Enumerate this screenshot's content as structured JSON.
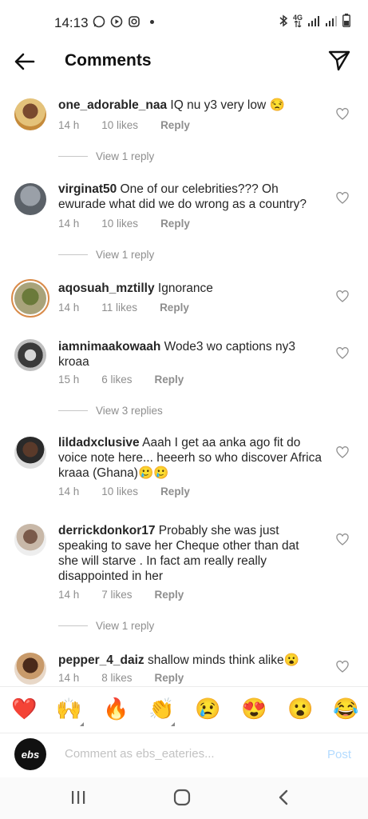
{
  "status_bar": {
    "time": "14:13",
    "network": "4G"
  },
  "header": {
    "title": "Comments"
  },
  "comments": [
    {
      "username": "one_adorable_naa",
      "text": "IQ nu y3 very low 😒",
      "time": "14 h",
      "likes": "10 likes",
      "reply": "Reply",
      "view_replies": "View 1 reply"
    },
    {
      "username": "virginat50",
      "text": "One of our celebrities??? Oh ewurade what did we do wrong as a country?",
      "time": "14 h",
      "likes": "10 likes",
      "reply": "Reply",
      "view_replies": "View 1 reply"
    },
    {
      "username": "aqosuah_mztilly",
      "text": "Ignorance",
      "time": "14 h",
      "likes": "11 likes",
      "reply": "Reply"
    },
    {
      "username": "iamnimaakowaah",
      "text": "Wode3 wo captions ny3 kroaa",
      "time": "15 h",
      "likes": "6 likes",
      "reply": "Reply",
      "view_replies": "View 3 replies"
    },
    {
      "username": "lildadxclusive",
      "text": "Aaah I get aa anka ago fit do voice note here... heeerh so who discover Africa kraaa (Ghana)🥲🥲",
      "time": "14 h",
      "likes": "10 likes",
      "reply": "Reply"
    },
    {
      "username": "derrickdonkor17",
      "text": "Probably she was just speaking to save her Cheque other than dat she will starve .  In fact am really really disappointed in her",
      "time": "14 h",
      "likes": "7 likes",
      "reply": "Reply",
      "view_replies": "View 1 reply"
    },
    {
      "username": "pepper_4_daiz",
      "text": "shallow minds think alike😮",
      "time": "14 h",
      "likes": "8 likes",
      "reply": "Reply"
    }
  ],
  "reactions": [
    "❤️",
    "🙌",
    "🔥",
    "👏",
    "😢",
    "😍",
    "😮",
    "😂"
  ],
  "composer": {
    "avatar_text": "ebs",
    "placeholder": "Comment as ebs_eateries...",
    "post_label": "Post"
  },
  "colors": {
    "meta_gray": "#8e8e8e",
    "post_blue": "#b3dbff",
    "text": "#262626"
  }
}
